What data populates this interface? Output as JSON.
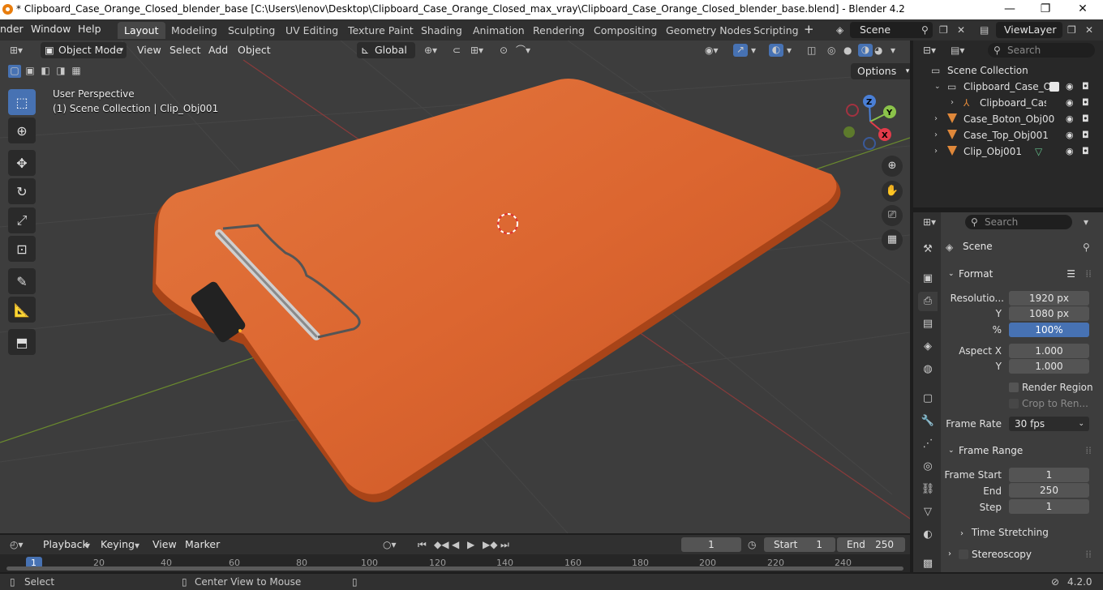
{
  "window": {
    "title": "* Clipboard_Case_Orange_Closed_blender_base [C:\\Users\\lenov\\Desktop\\Clipboard_Case_Orange_Closed_max_vray\\Clipboard_Case_Orange_Closed_blender_base.blend] - Blender 4.2",
    "minimize": "—",
    "maximize": "❐",
    "close": "✕"
  },
  "menu": {
    "items": [
      "nder",
      "Window",
      "Help"
    ]
  },
  "workspaces": [
    "Layout",
    "Modeling",
    "Sculpting",
    "UV Editing",
    "Texture Paint",
    "Shading",
    "Animation",
    "Rendering",
    "Compositing",
    "Geometry Nodes",
    "Scripting"
  ],
  "active_workspace": "Layout",
  "scene_name": "Scene",
  "view_layer": "ViewLayer",
  "viewport": {
    "mode": "Object Mode",
    "menus": [
      "View",
      "Select",
      "Add",
      "Object"
    ],
    "orientation": "Global",
    "perspective_label": "User Perspective",
    "collection_label": "(1) Scene Collection | Clip_Obj001",
    "options_label": "Options",
    "gizmo": {
      "x": "X",
      "y": "Y",
      "z": "Z"
    }
  },
  "outliner": {
    "search_placeholder": "Search",
    "root": "Scene Collection",
    "items": [
      {
        "name": "Clipboard_Case_Or",
        "level": 1
      },
      {
        "name": "Clipboard_Case",
        "level": 2
      },
      {
        "name": "Case_Boton_Obj00",
        "level": 1
      },
      {
        "name": "Case_Top_Obj001",
        "level": 1
      },
      {
        "name": "Clip_Obj001",
        "level": 1
      }
    ]
  },
  "properties": {
    "search_placeholder": "Search",
    "context": "Scene",
    "format": {
      "header": "Format",
      "resolution_label": "Resolutio...",
      "res_x": "1920 px",
      "res_y_label": "Y",
      "res_y": "1080 px",
      "pct_label": "%",
      "pct": "100%",
      "aspect_x_label": "Aspect X",
      "aspect_x": "1.000",
      "aspect_y_label": "Y",
      "aspect_y": "1.000",
      "render_region": "Render Region",
      "crop": "Crop to Ren...",
      "frame_rate_label": "Frame Rate",
      "frame_rate": "30 fps"
    },
    "frame_range": {
      "header": "Frame Range",
      "start_label": "Frame Start",
      "start": "1",
      "end_label": "End",
      "end": "250",
      "step_label": "Step",
      "step": "1",
      "time_stretching": "Time Stretching"
    },
    "stereoscopy": "Stereoscopy"
  },
  "timeline": {
    "menus": [
      "Playback",
      "Keying",
      "View",
      "Marker"
    ],
    "current_frame": "1",
    "start_label": "Start",
    "start": "1",
    "end_label": "End",
    "end": "250",
    "ruler": [
      "1",
      "20",
      "40",
      "60",
      "80",
      "100",
      "120",
      "140",
      "160",
      "180",
      "200",
      "220",
      "240"
    ]
  },
  "statusbar": {
    "select": "Select",
    "center": "Center View to Mouse",
    "version": "4.2.0"
  },
  "colors": {
    "accent": "#4772b3",
    "clipboard": "#e0622a",
    "blender_orange": "#e87d0d"
  }
}
